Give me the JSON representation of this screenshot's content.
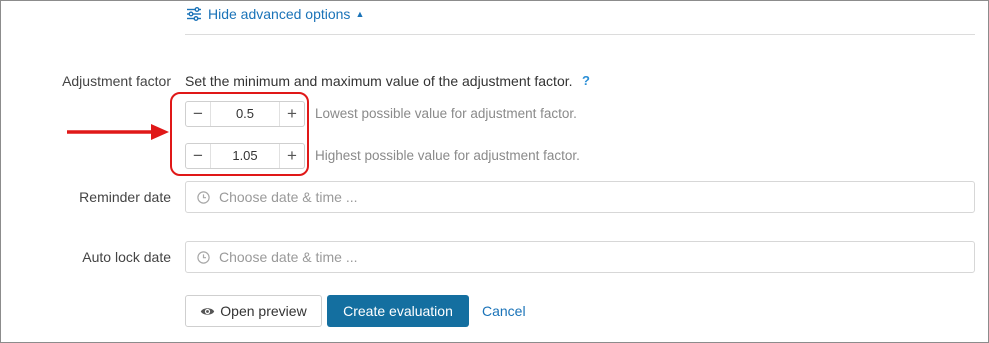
{
  "advanced": {
    "toggle_label": "Hide advanced options",
    "icon": "sliders-icon",
    "caret": "caret-up-icon"
  },
  "adjustment": {
    "label": "Adjustment factor",
    "help_text": "Set the minimum and maximum value of the adjustment factor.",
    "help_q": "?",
    "min": {
      "value": "0.5",
      "hint": "Lowest possible value for adjustment factor."
    },
    "max": {
      "value": "1.05",
      "hint": "Highest possible value for adjustment factor."
    },
    "minus_glyph": "−",
    "plus_glyph": "+"
  },
  "reminder": {
    "label": "Reminder date",
    "placeholder": "Choose date & time ..."
  },
  "autolock": {
    "label": "Auto lock date",
    "placeholder": "Choose date & time ..."
  },
  "actions": {
    "preview_label": "Open preview",
    "create_label": "Create evaluation",
    "cancel_label": "Cancel"
  },
  "colors": {
    "accent": "#1a73b8",
    "primary_button": "#146fa0",
    "annotation": "#e01818"
  }
}
